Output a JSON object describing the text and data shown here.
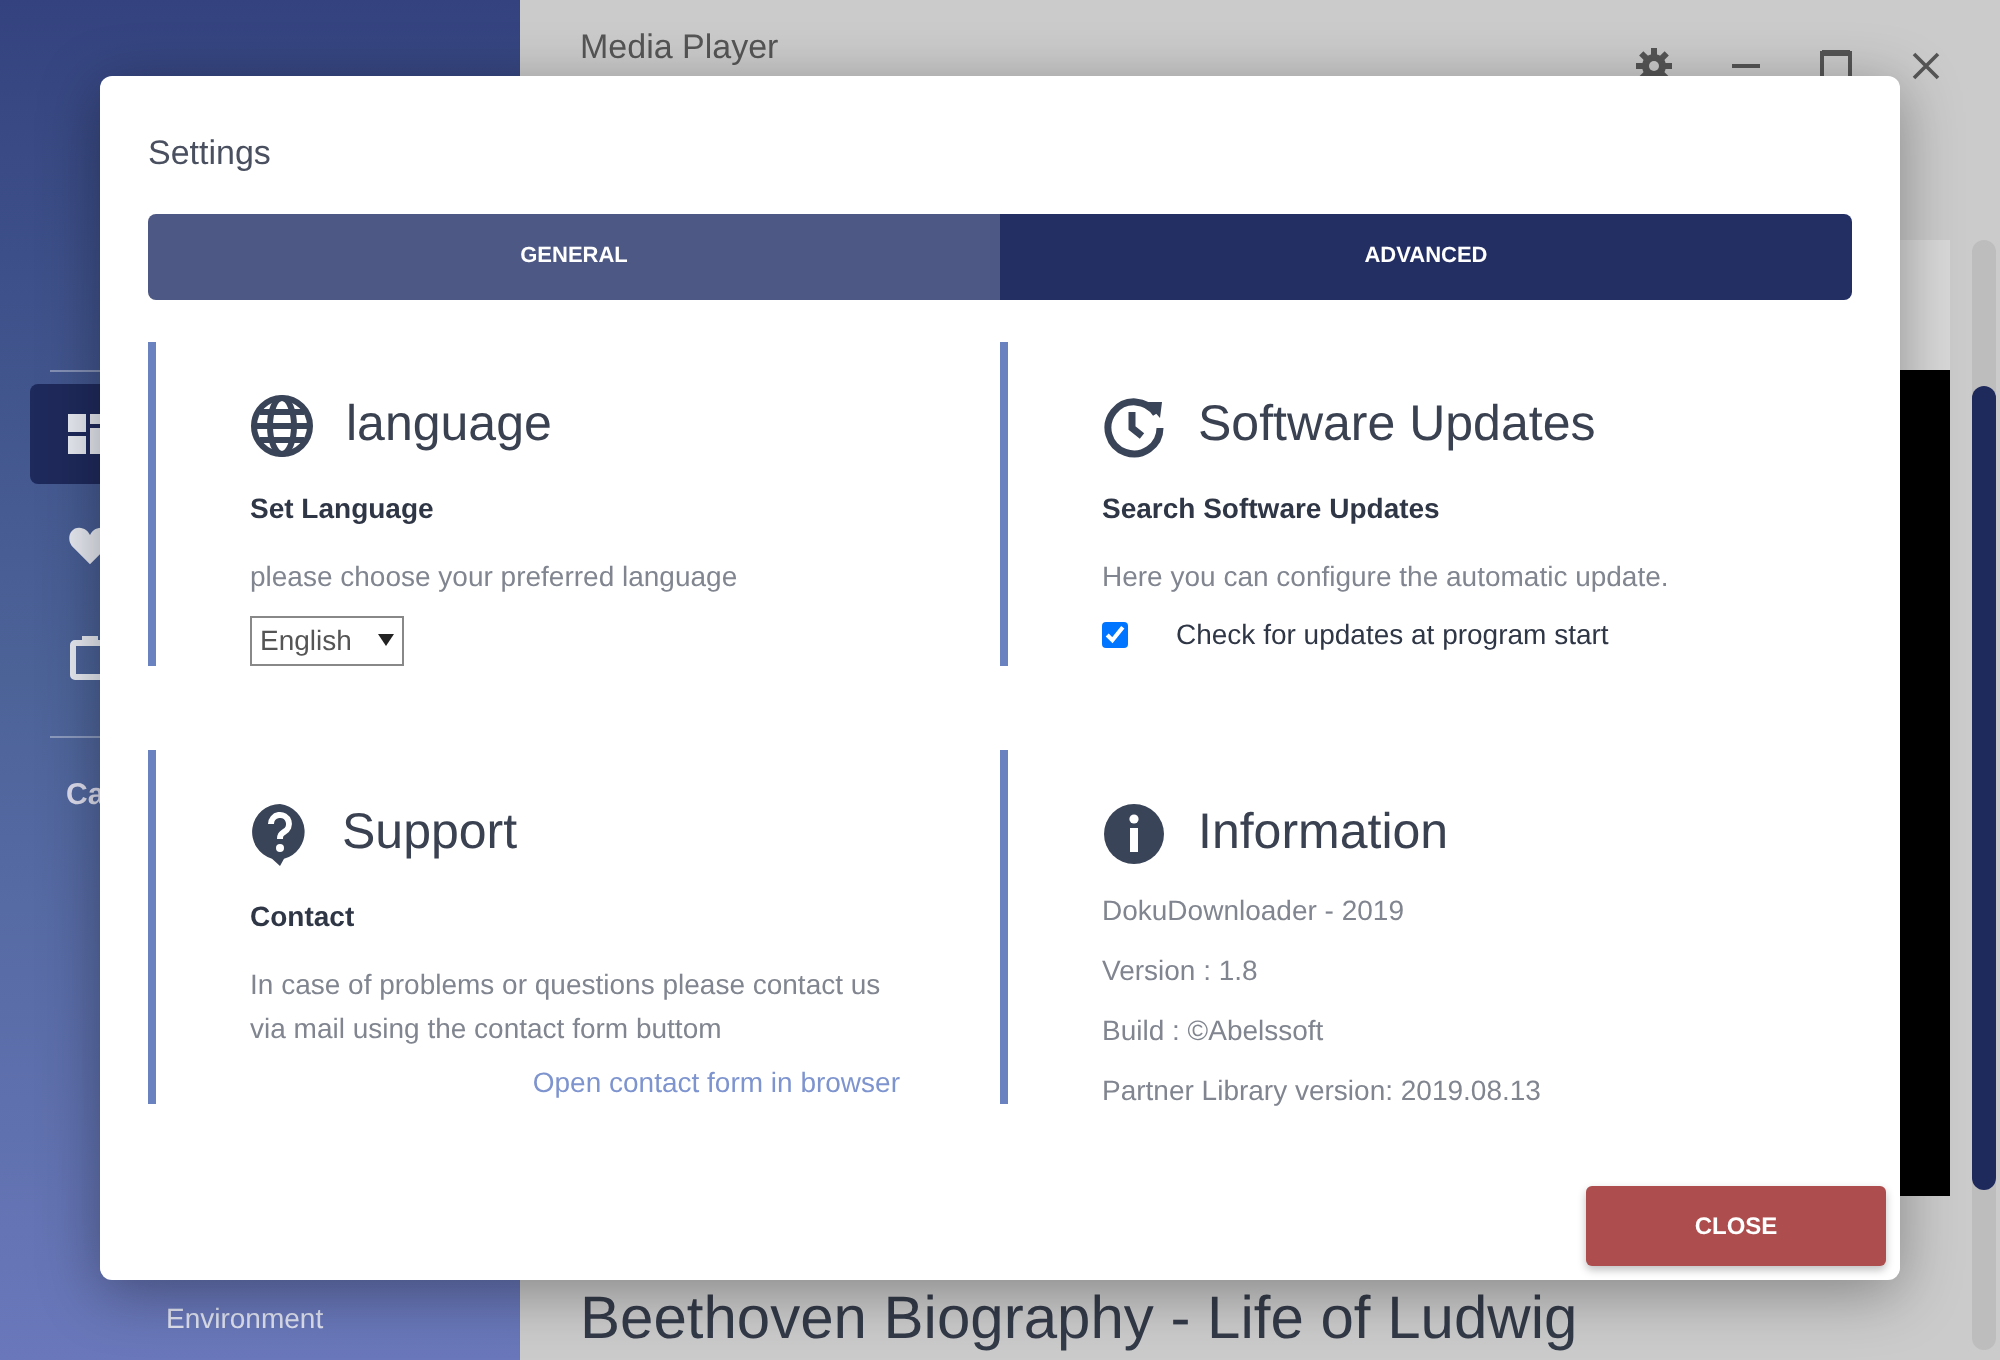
{
  "app": {
    "sidebar": {
      "items": [
        {
          "kind": "icon",
          "selected": true
        },
        {
          "kind": "icon",
          "selected": false
        },
        {
          "kind": "icon",
          "selected": false
        },
        {
          "kind": "label",
          "label": "Ca"
        }
      ],
      "footer_item": "Environment"
    },
    "main": {
      "title": "Media Player",
      "video_title": "Beethoven Biography - Life of Ludwig"
    }
  },
  "dialog": {
    "title": "Settings",
    "tabs": [
      {
        "label": "GENERAL",
        "selected": true
      },
      {
        "label": "ADVANCED",
        "selected": false
      }
    ],
    "sections": [
      {
        "kind": "select",
        "title": "language",
        "subtitle": "Set Language",
        "text": "please choose your preferred language",
        "value": "English"
      },
      {
        "kind": "checkbox",
        "title": "Software Updates",
        "subtitle": "Search Software Updates",
        "text": "Here you can configure the automatic update.",
        "option": "Check for updates at program start",
        "checked": true
      },
      {
        "kind": "link",
        "title": "Support",
        "subtitle": "Contact",
        "text": "In case of problems or questions please contact us via mail using the contact form buttom",
        "link": "Open contact form in browser"
      },
      {
        "kind": "lines",
        "title": "Information",
        "lines": [
          "DokuDownloader - 2019",
          "Version : 1.8",
          "Build : ©Abelssoft",
          "Partner Library version: 2019.08.13"
        ]
      }
    ],
    "close_button": "CLOSE"
  }
}
